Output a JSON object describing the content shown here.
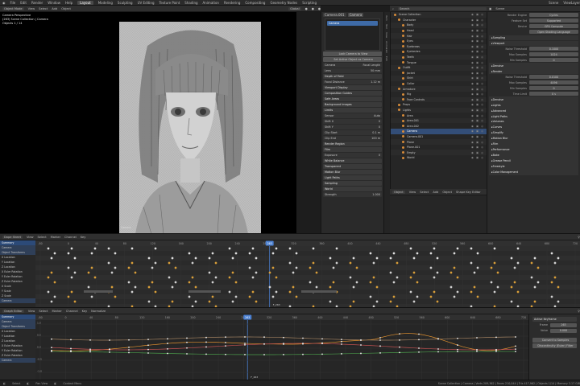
{
  "menu": {
    "app_menus": [
      "File",
      "Edit",
      "Render",
      "Window",
      "Help"
    ],
    "workspaces": [
      "Layout",
      "Modeling",
      "Sculpting",
      "UV Editing",
      "Texture Paint",
      "Shading",
      "Animation",
      "Rendering",
      "Compositing",
      "Geometry Nodes",
      "Scripting"
    ],
    "active_workspace": "Layout",
    "scene": "Scene",
    "view_layer": "ViewLayer"
  },
  "viewport": {
    "header": [
      "Object Mode",
      "View",
      "Select",
      "Add",
      "Object"
    ],
    "shading_label": "Global",
    "overlay_lines": [
      "Camera Perspective",
      "(263) Scene Collection | Camera",
      "Objects  1 / 14"
    ],
    "camera_name": "Camera"
  },
  "camera_props": {
    "tabs": [
      "Camera.001",
      "Camera"
    ],
    "lock_button": "Lock Camera to View",
    "active_button": "Set Active Object as Camera",
    "rows": [
      {
        "label": "Camera",
        "value": "Focal Length"
      },
      {
        "label": "Lens",
        "value": "50 mm"
      },
      {
        "label": "Depth of Field",
        "value": ""
      },
      {
        "label": "Focal Distance",
        "value": "1.12 m"
      },
      {
        "label": "Viewport Display",
        "value": ""
      },
      {
        "label": "Composition Guides",
        "value": ""
      },
      {
        "label": "Safe Areas",
        "value": ""
      },
      {
        "label": "Background Images",
        "value": ""
      },
      {
        "label": "Limits",
        "value": ""
      },
      {
        "label": "Sensor",
        "value": "Auto"
      },
      {
        "label": "Shift X",
        "value": "0"
      },
      {
        "label": "Shift Y",
        "value": "0"
      },
      {
        "label": "Clip Start",
        "value": "0.1 m"
      },
      {
        "label": "Clip End",
        "value": "100 m"
      },
      {
        "label": "Render Region",
        "value": ""
      },
      {
        "label": "Film",
        "value": ""
      },
      {
        "label": "Exposure",
        "value": "0"
      },
      {
        "label": "White Balance",
        "value": ""
      },
      {
        "label": "Transparent",
        "value": ""
      },
      {
        "label": "Motion Blur",
        "value": ""
      },
      {
        "label": "Light Paths",
        "value": ""
      },
      {
        "label": "Sampling",
        "value": ""
      }
    ],
    "world_label": "World",
    "strength_label": "Strength",
    "strength_value": "1.000"
  },
  "side_tabs": [
    "Item",
    "Tool",
    "View",
    "Animation",
    "Edit"
  ],
  "outliner": {
    "search_placeholder": "Search",
    "rows": [
      {
        "name": "Scene Collection",
        "sel": false
      },
      {
        "name": "Character",
        "sel": false
      },
      {
        "name": "Body",
        "sel": false
      },
      {
        "name": "Head",
        "sel": false
      },
      {
        "name": "Hair",
        "sel": false
      },
      {
        "name": "Eyes",
        "sel": false
      },
      {
        "name": "Eyebrows",
        "sel": false
      },
      {
        "name": "Eyelashes",
        "sel": false
      },
      {
        "name": "Teeth",
        "sel": false
      },
      {
        "name": "Tongue",
        "sel": false
      },
      {
        "name": "Outfit",
        "sel": false
      },
      {
        "name": "Jacket",
        "sel": false
      },
      {
        "name": "Shirt",
        "sel": false
      },
      {
        "name": "Collar",
        "sel": false
      },
      {
        "name": "Armature",
        "sel": false
      },
      {
        "name": "Rig",
        "sel": false
      },
      {
        "name": "Face Controls",
        "sel": false
      },
      {
        "name": "Props",
        "sel": false
      },
      {
        "name": "Lights",
        "sel": false
      },
      {
        "name": "Area",
        "sel": false
      },
      {
        "name": "Area.001",
        "sel": false
      },
      {
        "name": "Area.002",
        "sel": false
      },
      {
        "name": "Camera",
        "sel": true
      },
      {
        "name": "Camera.001",
        "sel": false
      },
      {
        "name": "Plane",
        "sel": false
      },
      {
        "name": "Plane.001",
        "sel": false
      },
      {
        "name": "Empty",
        "sel": false
      },
      {
        "name": "World",
        "sel": false
      }
    ],
    "footer": [
      "Object",
      "View",
      "Select",
      "Add",
      "Object",
      "Shape Key Editor"
    ]
  },
  "render_props": {
    "title": "Scene",
    "rows": [
      {
        "type": "kv",
        "k": "Render Engine",
        "v": "Cycles"
      },
      {
        "type": "kv",
        "k": "Feature Set",
        "v": "Supported"
      },
      {
        "type": "kv",
        "k": "Device",
        "v": "GPU Compute"
      },
      {
        "type": "kv",
        "k": "",
        "v": "Open Shading Language"
      },
      {
        "type": "sec",
        "k": "Sampling",
        "v": ""
      },
      {
        "type": "sec",
        "k": "Viewport",
        "v": ""
      },
      {
        "type": "kv",
        "k": "Noise Threshold",
        "v": "0.1000"
      },
      {
        "type": "kv",
        "k": "Max Samples",
        "v": "1024"
      },
      {
        "type": "kv",
        "k": "Min Samples",
        "v": "0"
      },
      {
        "type": "sec",
        "k": "Denoise",
        "v": ""
      },
      {
        "type": "sec",
        "k": "Render",
        "v": ""
      },
      {
        "type": "kv",
        "k": "Noise Threshold",
        "v": "0.0100"
      },
      {
        "type": "kv",
        "k": "Max Samples",
        "v": "4096"
      },
      {
        "type": "kv",
        "k": "Min Samples",
        "v": "0"
      },
      {
        "type": "kv",
        "k": "Time Limit",
        "v": "0 s"
      },
      {
        "type": "sec",
        "k": "Denoise",
        "v": ""
      },
      {
        "type": "sec",
        "k": "Lights",
        "v": ""
      },
      {
        "type": "sec",
        "k": "Advanced",
        "v": ""
      },
      {
        "type": "sec",
        "k": "Light Paths",
        "v": ""
      },
      {
        "type": "sec",
        "k": "Volumes",
        "v": ""
      },
      {
        "type": "sec",
        "k": "Curves",
        "v": ""
      },
      {
        "type": "sec",
        "k": "Simplify",
        "v": ""
      },
      {
        "type": "sec",
        "k": "Motion Blur",
        "v": ""
      },
      {
        "type": "sec",
        "k": "Film",
        "v": ""
      },
      {
        "type": "sec",
        "k": "Performance",
        "v": ""
      },
      {
        "type": "sec",
        "k": "Bake",
        "v": ""
      },
      {
        "type": "sec",
        "k": "Grease Pencil",
        "v": ""
      },
      {
        "type": "sec",
        "k": "Freestyle",
        "v": ""
      },
      {
        "type": "sec",
        "k": "Color Management",
        "v": ""
      }
    ]
  },
  "dopesheet": {
    "header": [
      "Dope Sheet",
      "View",
      "Select",
      "Marker",
      "Channel",
      "Key"
    ],
    "current_frame": "263",
    "frame_ticks": [
      "-80",
      "0",
      "40",
      "80",
      "120",
      "160",
      "200",
      "240",
      "280",
      "320",
      "360",
      "400",
      "440",
      "480",
      "520",
      "560",
      "600",
      "640",
      "680",
      "720"
    ],
    "end_label": "F_263",
    "channels": [
      {
        "name": "Summary",
        "kind": "hl"
      },
      {
        "name": "Camera",
        "kind": "sub"
      },
      {
        "name": "Object Transforms",
        "kind": "sub"
      },
      {
        "name": "X Location",
        "kind": ""
      },
      {
        "name": "Y Location",
        "kind": ""
      },
      {
        "name": "Z Location",
        "kind": ""
      },
      {
        "name": "X Euler Rotation",
        "kind": ""
      },
      {
        "name": "Y Euler Rotation",
        "kind": ""
      },
      {
        "name": "Z Euler Rotation",
        "kind": ""
      },
      {
        "name": "X Scale",
        "kind": ""
      },
      {
        "name": "Y Scale",
        "kind": ""
      },
      {
        "name": "Z Scale",
        "kind": ""
      },
      {
        "name": "Camera",
        "kind": "sub"
      }
    ]
  },
  "graph": {
    "header": [
      "Graph Editor",
      "View",
      "Select",
      "Marker",
      "Channel",
      "Key",
      "Normalize"
    ],
    "current_frame": "263",
    "frame_ticks": [
      "-80",
      "0",
      "40",
      "80",
      "120",
      "160",
      "200",
      "240",
      "280",
      "320",
      "360",
      "400",
      "440",
      "480",
      "520",
      "560",
      "600",
      "640",
      "680",
      "720"
    ],
    "y_ticks": [
      "1.0",
      "0.5",
      "0.0",
      "-0.5",
      "-1.0"
    ],
    "channels": [
      "Summary",
      "Camera",
      "Object Transforms",
      "X Location",
      "Y Location",
      "Z Location",
      "X Euler Rotation",
      "Y Euler Rotation",
      "Z Euler Rotation",
      "Camera"
    ],
    "active_key_title": "Active Keyframe",
    "active_key": [
      {
        "k": "Frame",
        "v": "263"
      },
      {
        "k": "Value",
        "v": "0.000"
      }
    ],
    "modifier_buttons": [
      "Convert to Samples",
      "Discontinuity (Euler) Filter"
    ],
    "end_label": "F_263"
  },
  "status": {
    "items": [
      "Select",
      "Pan View",
      "Context Menu"
    ],
    "right": "Scene Collection | Camera | Verts 209,362 | Faces 210,044 | Tris 417,962 | Objects 1/14 | Memory 3.17 GiB"
  }
}
